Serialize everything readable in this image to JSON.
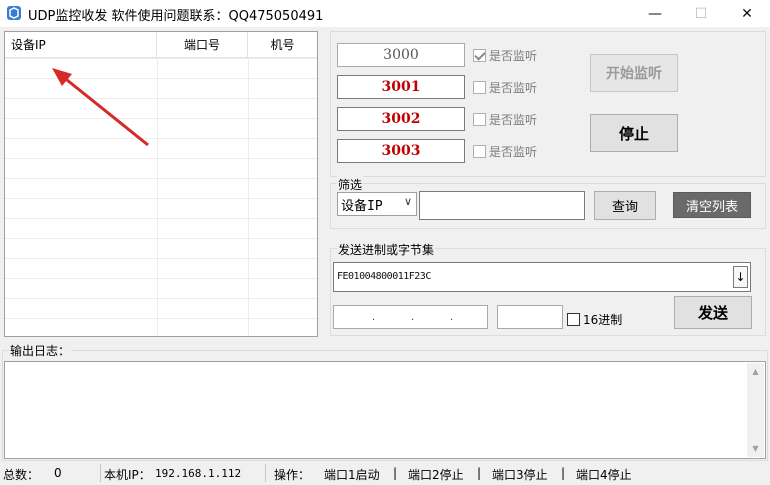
{
  "window": {
    "title": "UDP监控收发  软件使用问题联系：QQ475050491",
    "minimize": "—",
    "maximize": "☐",
    "close": "✕"
  },
  "device_list": {
    "columns": [
      "设备IP",
      "端口号",
      "机号"
    ]
  },
  "ports": [
    {
      "value": "3000",
      "checkbox_label": "是否监听",
      "checked": true
    },
    {
      "value": "3001",
      "checkbox_label": "是否监听",
      "checked": false
    },
    {
      "value": "3002",
      "checkbox_label": "是否监听",
      "checked": false
    },
    {
      "value": "3003",
      "checkbox_label": "是否监听",
      "checked": false
    }
  ],
  "buttons": {
    "start": "开始监听",
    "stop": "停止",
    "query": "查询",
    "clear": "清空列表",
    "send": "发送"
  },
  "filter": {
    "label": "筛选",
    "select_value": "设备IP",
    "select_arrow": "∨",
    "input_value": ""
  },
  "send": {
    "label": "发送进制或字节集",
    "hex_value": "FE01004800011F23C",
    "dropdown": "↓",
    "ip_dots": ".        .        .",
    "hex_checkbox_label": "16进制"
  },
  "log": {
    "label": "输出日志：",
    "scroll_up": "▲",
    "scroll_down": "▼"
  },
  "status": {
    "total_label": "总数：",
    "total_value": "0",
    "local_ip_label": "本机IP：",
    "local_ip_value": "192.168.1.112",
    "op_label": "操作：",
    "port1": "端口1启动",
    "port2": "端口2停止",
    "port3": "端口3停止",
    "port4": "端口4停止",
    "pipe": "|"
  },
  "colors": {
    "port_active": "#c00000",
    "arrow": "#d62a2a",
    "clear_button_bg": "#6a6a6a"
  }
}
